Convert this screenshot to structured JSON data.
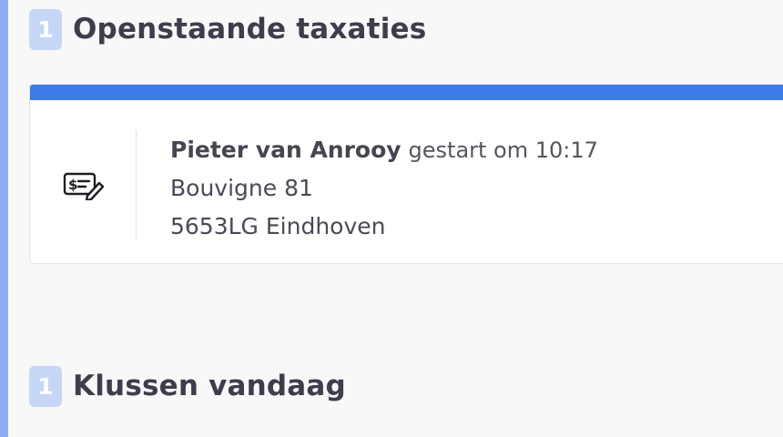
{
  "sections": [
    {
      "count": "1",
      "title": "Openstaande taxaties"
    },
    {
      "count": "1",
      "title": "Klussen vandaag"
    }
  ],
  "taxation_card": {
    "icon": "check-pen-icon",
    "name": "Pieter van Anrooy",
    "status": "gestart om 10:17",
    "street": "Bouvigne 81",
    "city": "5653LG Eindhoven"
  },
  "colors": {
    "accent_bar": "#3d7be6",
    "badge": "#c6d6f7",
    "left_accent": "#8aacf0"
  }
}
